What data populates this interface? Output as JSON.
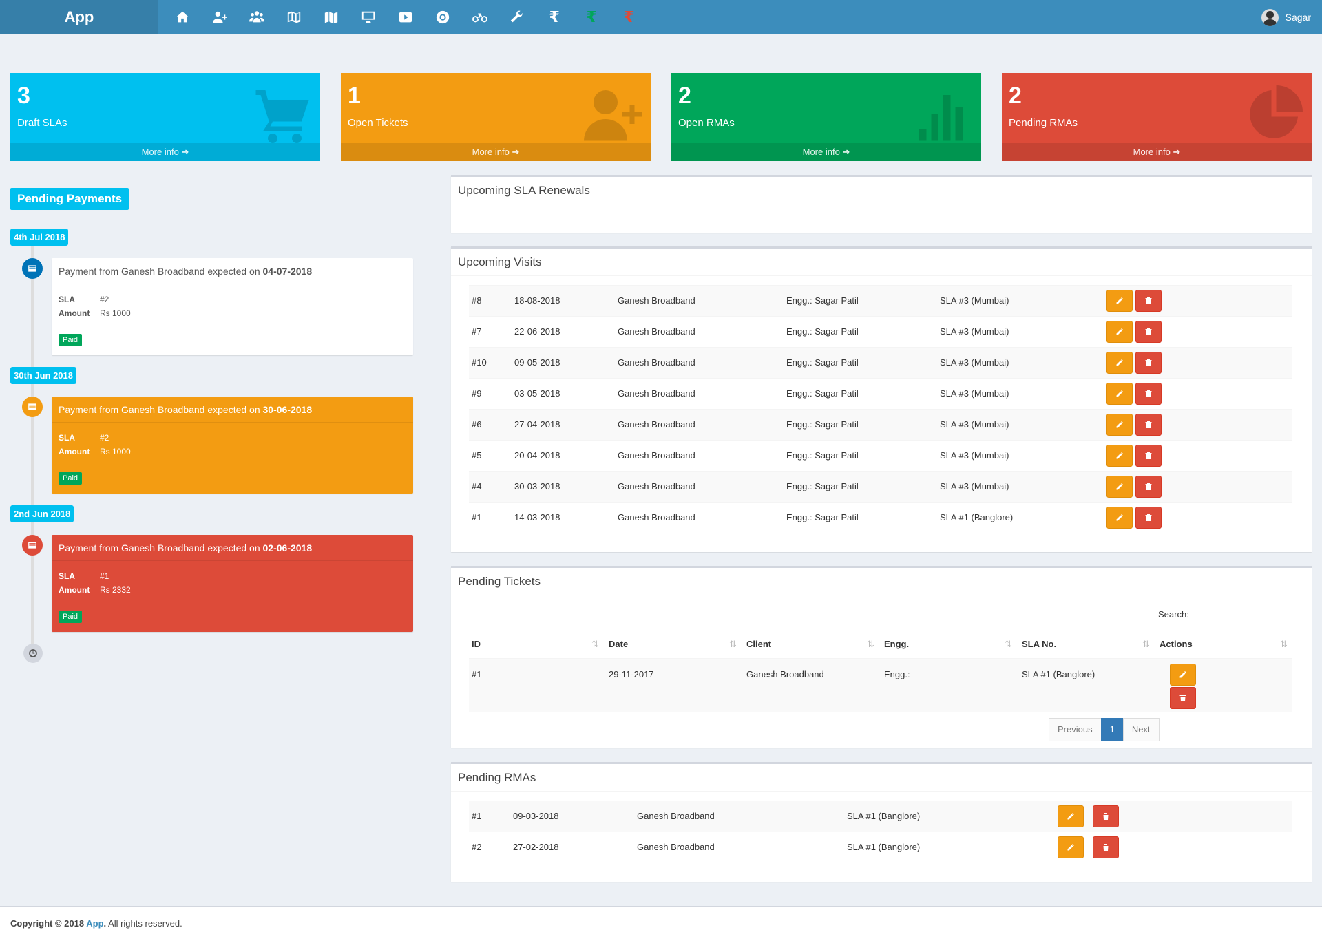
{
  "brand": "App",
  "header": {
    "icons": [
      "home-icon",
      "user-plus-icon",
      "users-icon",
      "map-outline-icon",
      "map-icon",
      "desktop-icon",
      "youtube-icon",
      "life-ring-icon",
      "bicycle-icon",
      "wrench-icon",
      "rupee-icon",
      "rupee-green-icon",
      "rupee-red-icon"
    ],
    "rupee_symbol": "₹",
    "user_name": "Sagar"
  },
  "colors": {
    "aqua": "#00c0ef",
    "yellow": "#f39c12",
    "green": "#00a65a",
    "red": "#dd4b39",
    "header": "#3c8dbc"
  },
  "stats": [
    {
      "value": "3",
      "label": "Draft SLAs",
      "more": "More info",
      "icon": "shopping-cart-icon"
    },
    {
      "value": "1",
      "label": "Open Tickets",
      "more": "More info",
      "icon": "user-plus-icon"
    },
    {
      "value": "2",
      "label": "Open RMAs",
      "more": "More info",
      "icon": "bar-chart-icon"
    },
    {
      "value": "2",
      "label": "Pending RMAs",
      "more": "More info",
      "icon": "pie-chart-icon"
    }
  ],
  "payments": {
    "title": "Pending Payments",
    "items": [
      {
        "date": "4th Jul 2018",
        "text": "Payment from Ganesh Broadband expected on ",
        "expected": "04-07-2018",
        "sla_label": "SLA",
        "sla": "#2",
        "amount_label": "Amount",
        "amount": "Rs 1000",
        "status": "Paid"
      },
      {
        "date": "30th Jun 2018",
        "text": "Payment from Ganesh Broadband expected on ",
        "expected": "30-06-2018",
        "sla_label": "SLA",
        "sla": "#2",
        "amount_label": "Amount",
        "amount": "Rs 1000",
        "status": "Paid"
      },
      {
        "date": "2nd Jun 2018",
        "text": "Payment from Ganesh Broadband expected on ",
        "expected": "02-06-2018",
        "sla_label": "SLA",
        "sla": "#1",
        "amount_label": "Amount",
        "amount": "Rs 2332",
        "status": "Paid"
      }
    ]
  },
  "renewals": {
    "title": "Upcoming SLA Renewals"
  },
  "visits": {
    "title": "Upcoming Visits",
    "rows": [
      {
        "id": "#8",
        "date": "18-08-2018",
        "client": "Ganesh Broadband",
        "engg": "Engg.: Sagar Patil",
        "sla": "SLA #3 (Mumbai)"
      },
      {
        "id": "#7",
        "date": "22-06-2018",
        "client": "Ganesh Broadband",
        "engg": "Engg.: Sagar Patil",
        "sla": "SLA #3 (Mumbai)"
      },
      {
        "id": "#10",
        "date": "09-05-2018",
        "client": "Ganesh Broadband",
        "engg": "Engg.: Sagar Patil",
        "sla": "SLA #3 (Mumbai)"
      },
      {
        "id": "#9",
        "date": "03-05-2018",
        "client": "Ganesh Broadband",
        "engg": "Engg.: Sagar Patil",
        "sla": "SLA #3 (Mumbai)"
      },
      {
        "id": "#6",
        "date": "27-04-2018",
        "client": "Ganesh Broadband",
        "engg": "Engg.: Sagar Patil",
        "sla": "SLA #3 (Mumbai)"
      },
      {
        "id": "#5",
        "date": "20-04-2018",
        "client": "Ganesh Broadband",
        "engg": "Engg.: Sagar Patil",
        "sla": "SLA #3 (Mumbai)"
      },
      {
        "id": "#4",
        "date": "30-03-2018",
        "client": "Ganesh Broadband",
        "engg": "Engg.: Sagar Patil",
        "sla": "SLA #3 (Mumbai)"
      },
      {
        "id": "#1",
        "date": "14-03-2018",
        "client": "Ganesh Broadband",
        "engg": "Engg.: Sagar Patil",
        "sla": "SLA #1 (Banglore)"
      }
    ]
  },
  "tickets": {
    "title": "Pending Tickets",
    "search_label": "Search:",
    "search_value": "",
    "columns": [
      "ID",
      "Date",
      "Client",
      "Engg.",
      "SLA No.",
      "Actions"
    ],
    "rows": [
      {
        "id": "#1",
        "date": "29-11-2017",
        "client": "Ganesh Broadband",
        "engg": "Engg.:",
        "sla": "SLA #1 (Banglore)"
      }
    ],
    "pager": {
      "previous": "Previous",
      "page": "1",
      "next": "Next"
    }
  },
  "rmas": {
    "title": "Pending RMAs",
    "rows": [
      {
        "id": "#1",
        "date": "09-03-2018",
        "client": "Ganesh Broadband",
        "sla": "SLA #1 (Banglore)"
      },
      {
        "id": "#2",
        "date": "27-02-2018",
        "client": "Ganesh Broadband",
        "sla": "SLA #1 (Banglore)"
      }
    ]
  },
  "footer": {
    "prefix": "Copyright © 2018 ",
    "link": "App",
    "dot": ".",
    "suffix": " All rights reserved."
  }
}
